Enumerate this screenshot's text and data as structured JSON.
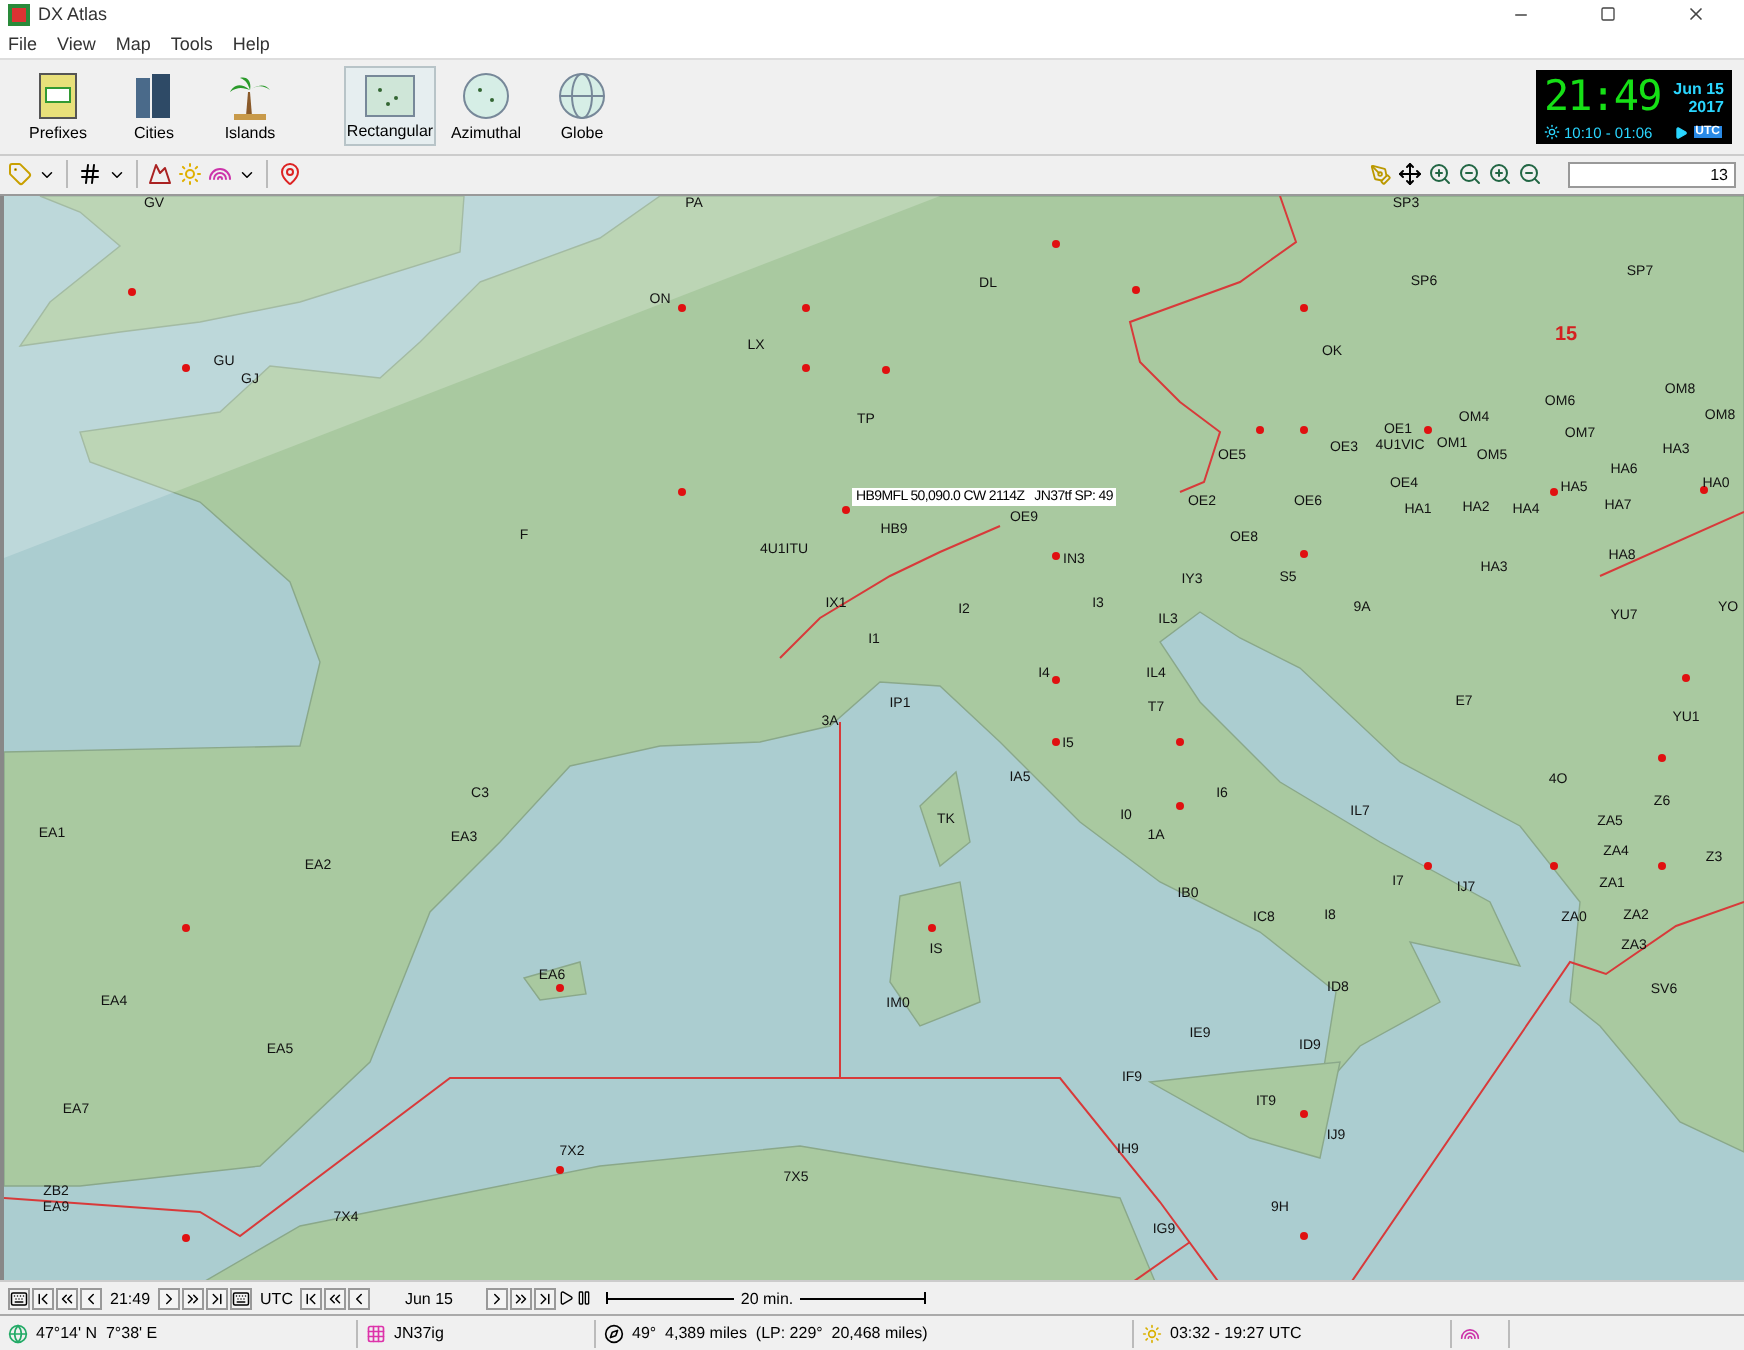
{
  "window": {
    "title": "DX Atlas"
  },
  "menu": [
    "File",
    "View",
    "Map",
    "Tools",
    "Help"
  ],
  "toolbar": {
    "buttons": [
      {
        "label": "Prefixes",
        "kind": "prefixes",
        "selected": false
      },
      {
        "label": "Cities",
        "kind": "cities",
        "selected": false
      },
      {
        "label": "Islands",
        "kind": "islands",
        "selected": false
      },
      {
        "label": "Rectangular",
        "kind": "rectangular",
        "selected": true
      },
      {
        "label": "Azimuthal",
        "kind": "azimuthal",
        "selected": false
      },
      {
        "label": "Globe",
        "kind": "globe",
        "selected": false
      }
    ]
  },
  "clock": {
    "time": "21:49",
    "date": "Jun 15",
    "year": "2017",
    "sun": "10:10 - 01:06",
    "zone": "UTC"
  },
  "zoom_field": {
    "value": "13"
  },
  "map": {
    "tooltip": "HB9MFL 50,090.0 CW 2114Z   JN37tf SP: 49",
    "labels": [
      {
        "text": "GV",
        "kind": "prefix"
      },
      {
        "text": "PA",
        "kind": "prefix"
      },
      {
        "text": "SP3",
        "kind": "prefix"
      },
      {
        "text": "ON",
        "kind": "prefix"
      },
      {
        "text": "DL",
        "kind": "prefix"
      },
      {
        "text": "SP6",
        "kind": "prefix"
      },
      {
        "text": "SP7",
        "kind": "prefix"
      },
      {
        "text": "LX",
        "kind": "prefix"
      },
      {
        "text": "OK",
        "kind": "prefix"
      },
      {
        "text": "15",
        "kind": "zone"
      },
      {
        "text": "GU",
        "kind": "prefix"
      },
      {
        "text": "GJ",
        "kind": "prefix"
      },
      {
        "text": "OM6",
        "kind": "prefix"
      },
      {
        "text": "OM8",
        "kind": "prefix"
      },
      {
        "text": "TP",
        "kind": "prefix"
      },
      {
        "text": "OM4",
        "kind": "prefix"
      },
      {
        "text": "OM8",
        "kind": "prefix"
      },
      {
        "text": "OE5",
        "kind": "prefix"
      },
      {
        "text": "OE3",
        "kind": "prefix"
      },
      {
        "text": "OE1",
        "kind": "prefix"
      },
      {
        "text": "4U1VIC",
        "kind": "prefix"
      },
      {
        "text": "OM1",
        "kind": "prefix"
      },
      {
        "text": "OM5",
        "kind": "prefix"
      },
      {
        "text": "OM7",
        "kind": "prefix"
      },
      {
        "text": "HA3",
        "kind": "prefix"
      },
      {
        "text": "OE4",
        "kind": "prefix"
      },
      {
        "text": "HA5",
        "kind": "prefix"
      },
      {
        "text": "HA6",
        "kind": "prefix"
      },
      {
        "text": "HA0",
        "kind": "prefix"
      },
      {
        "text": "OE9",
        "kind": "prefix"
      },
      {
        "text": "OE2",
        "kind": "prefix"
      },
      {
        "text": "OE6",
        "kind": "prefix"
      },
      {
        "text": "HA1",
        "kind": "prefix"
      },
      {
        "text": "HA2",
        "kind": "prefix"
      },
      {
        "text": "HA4",
        "kind": "prefix"
      },
      {
        "text": "HA7",
        "kind": "prefix"
      },
      {
        "text": "F",
        "kind": "prefix"
      },
      {
        "text": "4U1ITU",
        "kind": "prefix"
      },
      {
        "text": "HB9",
        "kind": "prefix"
      },
      {
        "text": "IN3",
        "kind": "prefix"
      },
      {
        "text": "OE8",
        "kind": "prefix"
      },
      {
        "text": "HA8",
        "kind": "prefix"
      },
      {
        "text": "IY3",
        "kind": "prefix"
      },
      {
        "text": "S5",
        "kind": "prefix"
      },
      {
        "text": "HA3",
        "kind": "prefix"
      },
      {
        "text": "IX1",
        "kind": "prefix"
      },
      {
        "text": "I2",
        "kind": "prefix"
      },
      {
        "text": "I3",
        "kind": "prefix"
      },
      {
        "text": "IL3",
        "kind": "prefix"
      },
      {
        "text": "9A",
        "kind": "prefix"
      },
      {
        "text": "YU7",
        "kind": "prefix"
      },
      {
        "text": "YO",
        "kind": "prefix"
      },
      {
        "text": "I1",
        "kind": "prefix"
      },
      {
        "text": "I4",
        "kind": "prefix"
      },
      {
        "text": "IL4",
        "kind": "prefix"
      },
      {
        "text": "3A",
        "kind": "prefix"
      },
      {
        "text": "IP1",
        "kind": "prefix"
      },
      {
        "text": "T7",
        "kind": "prefix"
      },
      {
        "text": "E7",
        "kind": "prefix"
      },
      {
        "text": "YU1",
        "kind": "prefix"
      },
      {
        "text": "I5",
        "kind": "prefix"
      },
      {
        "text": "IA5",
        "kind": "prefix"
      },
      {
        "text": "4O",
        "kind": "prefix"
      },
      {
        "text": "C3",
        "kind": "prefix"
      },
      {
        "text": "TK",
        "kind": "prefix"
      },
      {
        "text": "I0",
        "kind": "prefix"
      },
      {
        "text": "I6",
        "kind": "prefix"
      },
      {
        "text": "IL7",
        "kind": "prefix"
      },
      {
        "text": "ZA5",
        "kind": "prefix"
      },
      {
        "text": "Z6",
        "kind": "prefix"
      },
      {
        "text": "EA1",
        "kind": "prefix"
      },
      {
        "text": "EA3",
        "kind": "prefix"
      },
      {
        "text": "1A",
        "kind": "prefix"
      },
      {
        "text": "ZA4",
        "kind": "prefix"
      },
      {
        "text": "Z3",
        "kind": "prefix"
      },
      {
        "text": "EA2",
        "kind": "prefix"
      },
      {
        "text": "IB0",
        "kind": "prefix"
      },
      {
        "text": "I7",
        "kind": "prefix"
      },
      {
        "text": "IJ7",
        "kind": "prefix"
      },
      {
        "text": "ZA1",
        "kind": "prefix"
      },
      {
        "text": "IC8",
        "kind": "prefix"
      },
      {
        "text": "I8",
        "kind": "prefix"
      },
      {
        "text": "ZA0",
        "kind": "prefix"
      },
      {
        "text": "ZA2",
        "kind": "prefix"
      },
      {
        "text": "IS",
        "kind": "prefix"
      },
      {
        "text": "ZA3",
        "kind": "prefix"
      },
      {
        "text": "EA4",
        "kind": "prefix"
      },
      {
        "text": "EA6",
        "kind": "prefix"
      },
      {
        "text": "IM0",
        "kind": "prefix"
      },
      {
        "text": "ID8",
        "kind": "prefix"
      },
      {
        "text": "SV6",
        "kind": "prefix"
      },
      {
        "text": "EA5",
        "kind": "prefix"
      },
      {
        "text": "IE9",
        "kind": "prefix"
      },
      {
        "text": "ID9",
        "kind": "prefix"
      },
      {
        "text": "EA7",
        "kind": "prefix"
      },
      {
        "text": "IF9",
        "kind": "prefix"
      },
      {
        "text": "IT9",
        "kind": "prefix"
      },
      {
        "text": "7X2",
        "kind": "prefix"
      },
      {
        "text": "IH9",
        "kind": "prefix"
      },
      {
        "text": "IJ9",
        "kind": "prefix"
      },
      {
        "text": "ZB2",
        "kind": "prefix"
      },
      {
        "text": "7X5",
        "kind": "prefix"
      },
      {
        "text": "EA9",
        "kind": "prefix"
      },
      {
        "text": "7X4",
        "kind": "prefix"
      },
      {
        "text": "IG9",
        "kind": "prefix"
      },
      {
        "text": "9H",
        "kind": "prefix"
      }
    ]
  },
  "time_bar": {
    "time": "21:49",
    "zone": "UTC",
    "date": "Jun 15",
    "scale": "20 min."
  },
  "status_bar": {
    "position": "47°14' N  7°38' E",
    "locator": "JN37ig",
    "bearing": "49°  4,389 miles  (LP: 229°  20,468 miles)",
    "sun": "03:32 - 19:27 UTC"
  }
}
